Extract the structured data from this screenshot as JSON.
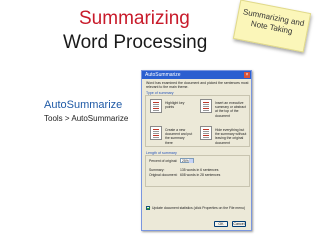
{
  "slide": {
    "title_line1": "Summarizing",
    "title_line2": "Word Processing",
    "sticky_note": "Summarizing and Note Taking",
    "feature_label": "AutoSummarize",
    "menu_path": "Tools > AutoSummarize"
  },
  "dialog": {
    "title": "AutoSummarize",
    "close_glyph": "×",
    "description": "Word has examined the document and picked the sentences most relevant to the main theme.",
    "type_label": "Type of summary",
    "options": [
      {
        "label": "Highlight key points"
      },
      {
        "label": "Insert an executive summary or abstract at the top of the document"
      },
      {
        "label": "Create a new document and put the summary there"
      },
      {
        "label": "Hide everything but the summary without leaving the original document"
      }
    ],
    "length_label": "Length of summary",
    "percent_label": "Percent of original:",
    "percent_value": "25%",
    "summary_label": "Summary:",
    "summary_value": "135 words in 6 sentences",
    "original_label": "Original document:",
    "original_value": "608 words in 28 sentences",
    "update_label": "Update document statistics (click Properties on the File menu)",
    "ok_label": "OK",
    "cancel_label": "Cancel"
  },
  "colors": {
    "title_red": "#c81a2a",
    "link_blue": "#1f5aa6",
    "xp_blue": "#2b5fd0",
    "dialog_bg": "#ece9d8",
    "note_yellow": "#fbf6b9"
  }
}
